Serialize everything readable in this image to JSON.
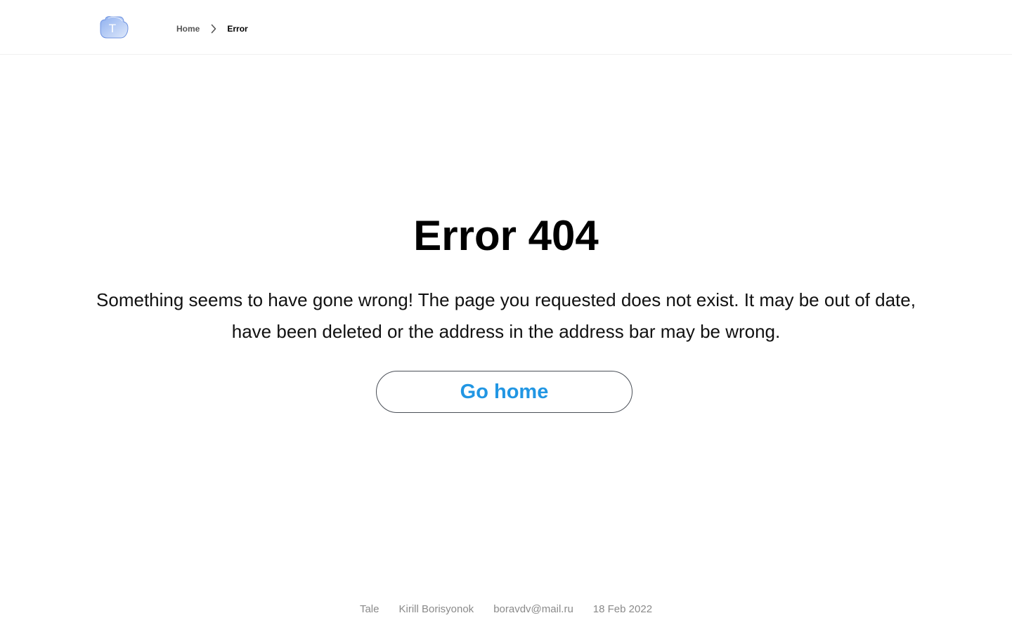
{
  "header": {
    "logo_letter": "T",
    "logo_colors": {
      "fill_light": "#dfe9fb",
      "fill_dark": "#8fb0ef",
      "stroke": "#6f93e0",
      "letter": "#ffffff"
    },
    "breadcrumb": {
      "home_label": "Home",
      "separator_icon": "chevron-right-icon",
      "current_label": "Error"
    }
  },
  "main": {
    "title": "Error 404",
    "message_line1": "Something seems to have gone wrong! The page you requested does not exist. It may be out of date,",
    "message_line2": "have been deleted or the address in the address bar may be wrong.",
    "button_label": "Go home"
  },
  "footer": {
    "site": "Tale",
    "author": "Kirill Borisyonok",
    "email": "boravdv@mail.ru",
    "date": "18 Feb 2022"
  },
  "colors": {
    "accent": "#2196e3",
    "button_border": "#4a4f57",
    "footer_text": "#8a8a8a",
    "header_border": "#f0f0f0"
  }
}
